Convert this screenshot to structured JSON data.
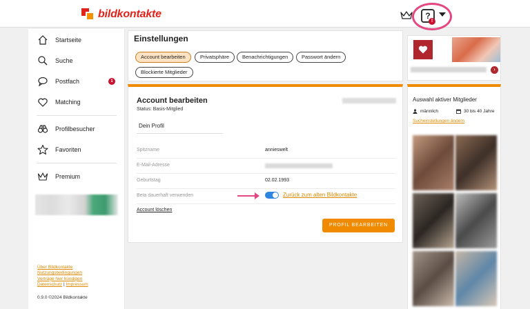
{
  "header": {
    "logo_text_a": "bild",
    "logo_text_b": "kontakte",
    "help_glyph": "?",
    "help_badge": "!"
  },
  "sidebar": {
    "items": [
      {
        "label": "Startseite",
        "icon": "home-icon"
      },
      {
        "label": "Suche",
        "icon": "search-icon"
      },
      {
        "label": "Postfach",
        "icon": "chat-bubble-icon",
        "badge": "1"
      },
      {
        "label": "Matching",
        "icon": "heart-hand-icon"
      },
      {
        "label": "Profilbesucher",
        "icon": "binoculars-icon"
      },
      {
        "label": "Favoriten",
        "icon": "star-icon"
      },
      {
        "label": "Premium",
        "icon": "crown-icon"
      }
    ],
    "footer_links": [
      "Über Bildkontakte",
      "Nutzungsbedingungen",
      "Verträge hier kündigen",
      "Datenschutz",
      "Impressum"
    ],
    "footer_separator": "|",
    "version": "0.9.0 ©2024 Bildkontakte"
  },
  "settings": {
    "title": "Einstellungen",
    "tabs": [
      "Account bearbeiten",
      "Privatsphäre",
      "Benachrichtigungen",
      "Passwort ändern",
      "Blockierte Mitglieder"
    ],
    "active_tab": "Account bearbeiten"
  },
  "account": {
    "title": "Account bearbeiten",
    "status": "Status: Basis-Mitglied",
    "profile_heading": "Dein Profil",
    "fields": [
      {
        "label": "Spitzname",
        "value": "annieswelt"
      },
      {
        "label": "E-Mail-Adresse",
        "value": ""
      },
      {
        "label": "Geburtstag",
        "value": "02.02.1993"
      },
      {
        "label": "Beta dauerhaft verwenden",
        "value": ""
      }
    ],
    "beta_enabled": true,
    "back_link": "Zurück zum alten Bildkontakte",
    "delete_link": "Account löschen",
    "edit_button": "PROFIL BEARBEITEN"
  },
  "members": {
    "title": "Auswahl aktiver Mitglieder",
    "gender_filter": "männlich",
    "age_filter": "30 bis 40 Jahre",
    "search_settings_link": "Sucheinstellungen ändern"
  },
  "colors": {
    "accent": "#f08a00",
    "brand_red": "#e2231a",
    "toggle_blue": "#2f86e0",
    "highlight_pink": "#e5467f",
    "badge_red": "#c8102e"
  }
}
